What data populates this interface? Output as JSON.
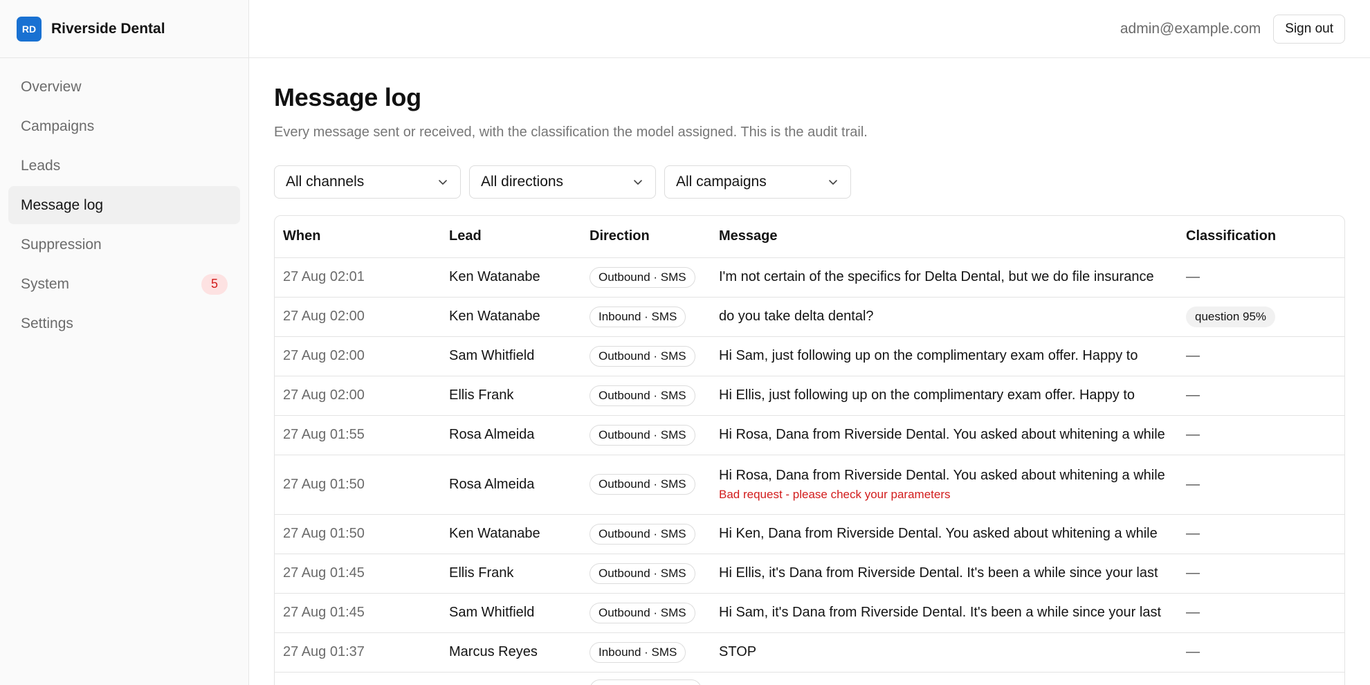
{
  "brand": {
    "logo_text": "RD",
    "name": "Riverside Dental",
    "logo_color": "#1971d2"
  },
  "sidebar": {
    "items": [
      {
        "label": "Overview"
      },
      {
        "label": "Campaigns"
      },
      {
        "label": "Leads"
      },
      {
        "label": "Message log",
        "active": true
      },
      {
        "label": "Suppression"
      },
      {
        "label": "System",
        "badge": "5"
      },
      {
        "label": "Settings"
      }
    ]
  },
  "header": {
    "user_email": "admin@example.com",
    "signout_label": "Sign out"
  },
  "page": {
    "title": "Message log",
    "subtitle": "Every message sent or received, with the classification the model assigned. This is the audit trail."
  },
  "filters": {
    "channel": "All channels",
    "direction": "All directions",
    "campaign": "All campaigns",
    "chevron_icon": "chevron-down-icon"
  },
  "table": {
    "columns": [
      "When",
      "Lead",
      "Direction",
      "Message",
      "Classification"
    ],
    "rows": [
      {
        "when": "27 Aug 02:01",
        "lead": "Ken Watanabe",
        "direction": "Outbound · SMS",
        "message": "I'm not certain of the specifics for Delta Dental, but we do file insurance",
        "classification": "—"
      },
      {
        "when": "27 Aug 02:00",
        "lead": "Ken Watanabe",
        "direction": "Inbound · SMS",
        "message": "do you take delta dental?",
        "classification": "question 95%"
      },
      {
        "when": "27 Aug 02:00",
        "lead": "Sam Whitfield",
        "direction": "Outbound · SMS",
        "message": "Hi Sam, just following up on the complimentary exam offer. Happy to",
        "classification": "—"
      },
      {
        "when": "27 Aug 02:00",
        "lead": "Ellis Frank",
        "direction": "Outbound · SMS",
        "message": "Hi Ellis, just following up on the complimentary exam offer. Happy to",
        "classification": "—"
      },
      {
        "when": "27 Aug 01:55",
        "lead": "Rosa Almeida",
        "direction": "Outbound · SMS",
        "message": "Hi Rosa, Dana from Riverside Dental. You asked about whitening a while",
        "classification": "—"
      },
      {
        "when": "27 Aug 01:50",
        "lead": "Rosa Almeida",
        "direction": "Outbound · SMS",
        "message": "Hi Rosa, Dana from Riverside Dental. You asked about whitening a while",
        "error": "Bad request - please check your parameters",
        "classification": "—"
      },
      {
        "when": "27 Aug 01:50",
        "lead": "Ken Watanabe",
        "direction": "Outbound · SMS",
        "message": "Hi Ken, Dana from Riverside Dental. You asked about whitening a while",
        "classification": "—"
      },
      {
        "when": "27 Aug 01:45",
        "lead": "Ellis Frank",
        "direction": "Outbound · SMS",
        "message": "Hi Ellis, it's Dana from Riverside Dental. It's been a while since your last",
        "classification": "—"
      },
      {
        "when": "27 Aug 01:45",
        "lead": "Sam Whitfield",
        "direction": "Outbound · SMS",
        "message": "Hi Sam, it's Dana from Riverside Dental. It's been a while since your last",
        "classification": "—"
      },
      {
        "when": "27 Aug 01:37",
        "lead": "Marcus Reyes",
        "direction": "Inbound · SMS",
        "message": "STOP",
        "classification": "—"
      },
      {
        "when": "",
        "lead": "",
        "direction": "",
        "message": "",
        "classification": ""
      }
    ]
  }
}
